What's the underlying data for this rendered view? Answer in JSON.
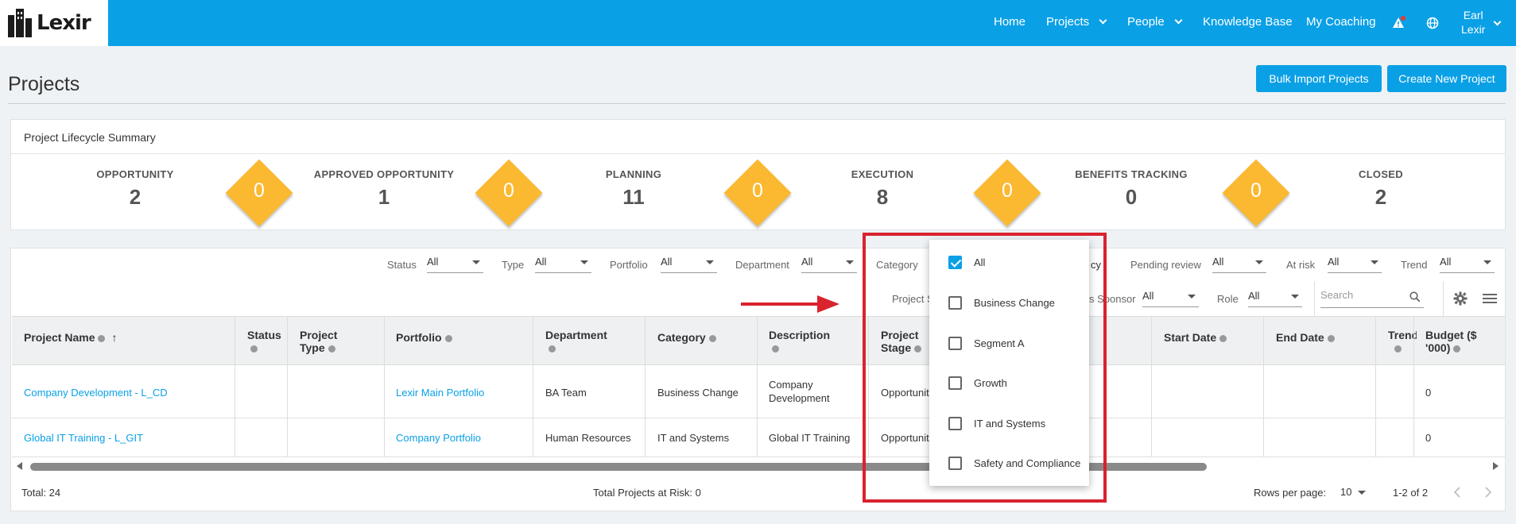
{
  "nav": {
    "brand": "Lexir",
    "items": [
      "Home",
      "Projects",
      "People",
      "Knowledge Base",
      "My Coaching"
    ],
    "user_first": "Earl",
    "user_last": "Lexir"
  },
  "page": {
    "title": "Projects",
    "bulk_import": "Bulk Import Projects",
    "create_new": "Create New Project"
  },
  "lifecycle": {
    "title": "Project Lifecycle Summary",
    "stages": [
      {
        "label": "OPPORTUNITY",
        "count": "2"
      },
      {
        "label": "APPROVED OPPORTUNITY",
        "count": "1"
      },
      {
        "label": "PLANNING",
        "count": "11"
      },
      {
        "label": "EXECUTION",
        "count": "8"
      },
      {
        "label": "BENEFITS TRACKING",
        "count": "0"
      },
      {
        "label": "CLOSED",
        "count": "2"
      }
    ],
    "transitions": [
      "0",
      "0",
      "0",
      "0",
      "0"
    ]
  },
  "filters": {
    "status": {
      "label": "Status",
      "value": "All"
    },
    "type": {
      "label": "Type",
      "value": "All"
    },
    "portfolio": {
      "label": "Portfolio",
      "value": "All"
    },
    "department": {
      "label": "Department",
      "value": "All"
    },
    "category": {
      "label": "Category"
    },
    "frequency_suffix": "cy",
    "pending_review": {
      "label": "Pending review",
      "value": "All"
    },
    "at_risk": {
      "label": "At risk",
      "value": "All"
    },
    "trend": {
      "label": "Trend",
      "value": "All"
    },
    "project_stage_partial": "Project S",
    "sponsor_partial": "s Sponsor",
    "sponsor_value": "All",
    "role": {
      "label": "Role",
      "value": "All"
    },
    "search_placeholder": "Search"
  },
  "table": {
    "headers": {
      "project_name": "Project Name",
      "status": "Status",
      "project_type_1": "Project",
      "project_type_2": "Type",
      "portfolio": "Portfolio",
      "department": "Department",
      "category": "Category",
      "description": "Description",
      "project_stage_1": "Project",
      "project_stage_2": "Stage",
      "start_date": "Start Date",
      "end_date": "End Date",
      "trend": "Trend",
      "budget_1": "Budget ($",
      "budget_2": "'000)"
    },
    "rows": [
      {
        "name": "Company Development - L_CD",
        "portfolio": "Lexir Main Portfolio",
        "department": "BA Team",
        "category": "Business Change",
        "description_1": "Company",
        "description_2": "Development",
        "stage": "Opportunit",
        "budget": "0"
      },
      {
        "name": "Global IT Training - L_GIT",
        "portfolio": "Company Portfolio",
        "department": "Human Resources",
        "category": "IT and Systems",
        "description_1": "Global IT Training",
        "description_2": "",
        "stage": "Opportunit",
        "budget": "0"
      }
    ]
  },
  "footer": {
    "total": "Total: 24",
    "at_risk": "Total Projects at Risk: 0",
    "rows_per_page_label": "Rows per page:",
    "rows_per_page_value": "10",
    "range": "1-2 of 2"
  },
  "category_dropdown": {
    "options": [
      {
        "label": "All",
        "checked": true
      },
      {
        "label": "Business Change",
        "checked": false
      },
      {
        "label": "Segment A",
        "checked": false
      },
      {
        "label": "Growth",
        "checked": false
      },
      {
        "label": "IT and Systems",
        "checked": false
      },
      {
        "label": "Safety and Compliance",
        "checked": false
      }
    ]
  },
  "colors": {
    "brand_blue": "#0aa0e6",
    "diamond_yellow": "#fbb831",
    "highlight_red": "#d9232e"
  }
}
